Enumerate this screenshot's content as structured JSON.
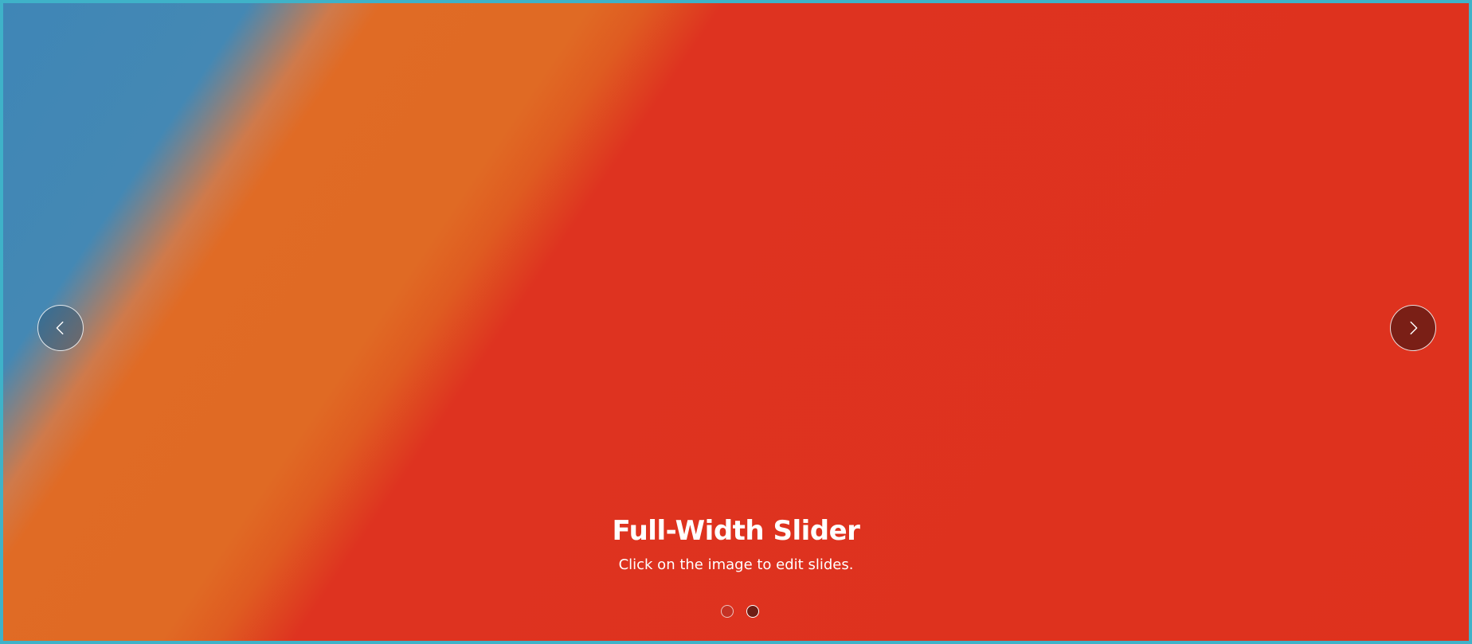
{
  "slider": {
    "title": "Full-Width Slider",
    "subtitle": "Click on the image to edit slides.",
    "slide_count": 2,
    "active_slide": 2,
    "prev_icon": "chevron-left-icon",
    "next_icon": "chevron-right-icon"
  },
  "colors": {
    "frame_border": "#3fb2c8",
    "slide_blue": "#4188b4",
    "slide_orange": "#e06a24",
    "slide_red": "#de321d"
  }
}
